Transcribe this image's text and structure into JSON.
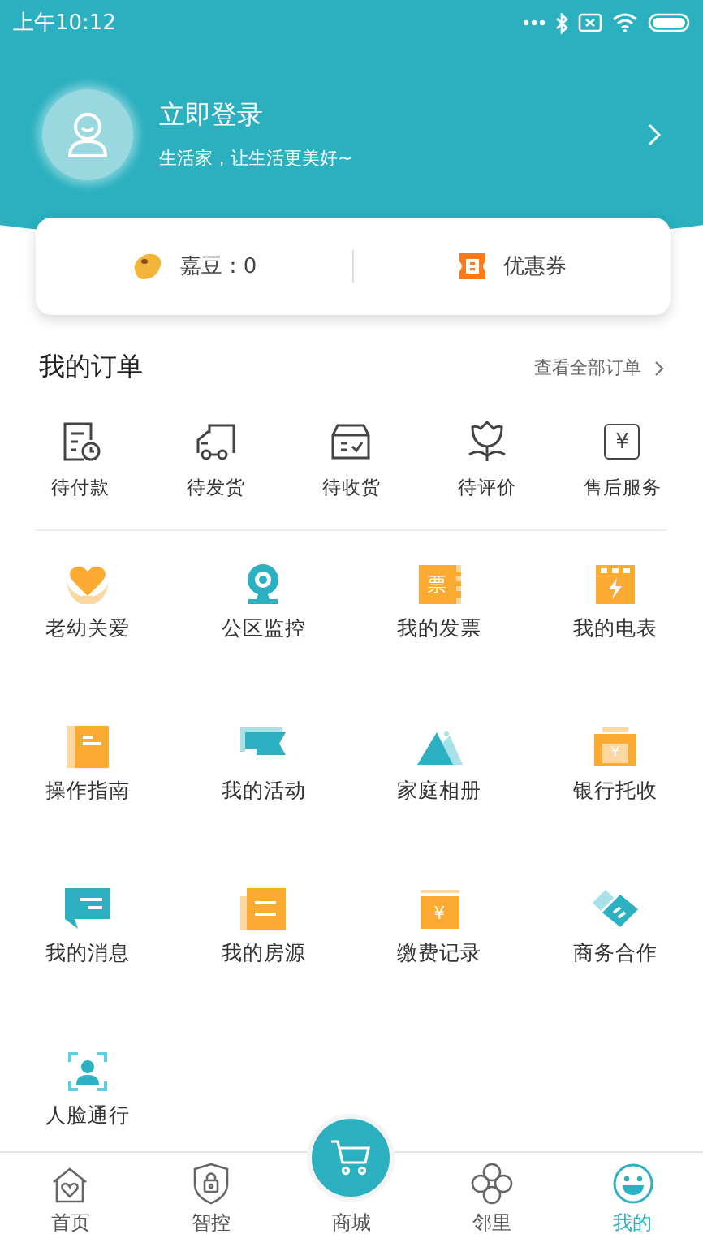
{
  "status_bar": {
    "time": "上午10:12"
  },
  "profile": {
    "title": "立即登录",
    "subtitle": "生活家，让生活更美好~"
  },
  "wallet": [
    {
      "kind": "bean",
      "label": "嘉豆：0"
    },
    {
      "kind": "coupon",
      "label": "优惠券"
    }
  ],
  "orders": {
    "title": "我的订单",
    "link": "查看全部订单",
    "items": [
      {
        "kind": "bill",
        "label": "待付款"
      },
      {
        "kind": "truck",
        "label": "待发货"
      },
      {
        "kind": "box",
        "label": "待收货"
      },
      {
        "kind": "flower",
        "label": "待评价"
      },
      {
        "kind": "refund",
        "label": "售后服务",
        "glyph": "¥"
      }
    ]
  },
  "services": [
    {
      "kind": "care",
      "label": "老幼关爱"
    },
    {
      "kind": "camera",
      "label": "公区监控"
    },
    {
      "kind": "invoice",
      "label": "我的发票",
      "glyph": "票"
    },
    {
      "kind": "meter",
      "label": "我的电表"
    },
    {
      "kind": "guide",
      "label": "操作指南"
    },
    {
      "kind": "flag",
      "label": "我的活动"
    },
    {
      "kind": "album",
      "label": "家庭相册"
    },
    {
      "kind": "printer",
      "label": "银行托收",
      "glyph": "¥"
    },
    {
      "kind": "message",
      "label": "我的消息"
    },
    {
      "kind": "house",
      "label": "我的房源"
    },
    {
      "kind": "payment",
      "label": "缴费记录",
      "glyph": "¥"
    },
    {
      "kind": "cooperate",
      "label": "商务合作"
    },
    {
      "kind": "face",
      "label": "人脸通行"
    }
  ],
  "tabs": [
    {
      "kind": "home",
      "label": "首页",
      "selected": false
    },
    {
      "kind": "lock",
      "label": "智控",
      "selected": false
    },
    {
      "kind": "cart",
      "label": "商城",
      "selected": false
    },
    {
      "kind": "clover",
      "label": "邻里",
      "selected": false
    },
    {
      "kind": "smile",
      "label": "我的",
      "selected": true
    }
  ]
}
